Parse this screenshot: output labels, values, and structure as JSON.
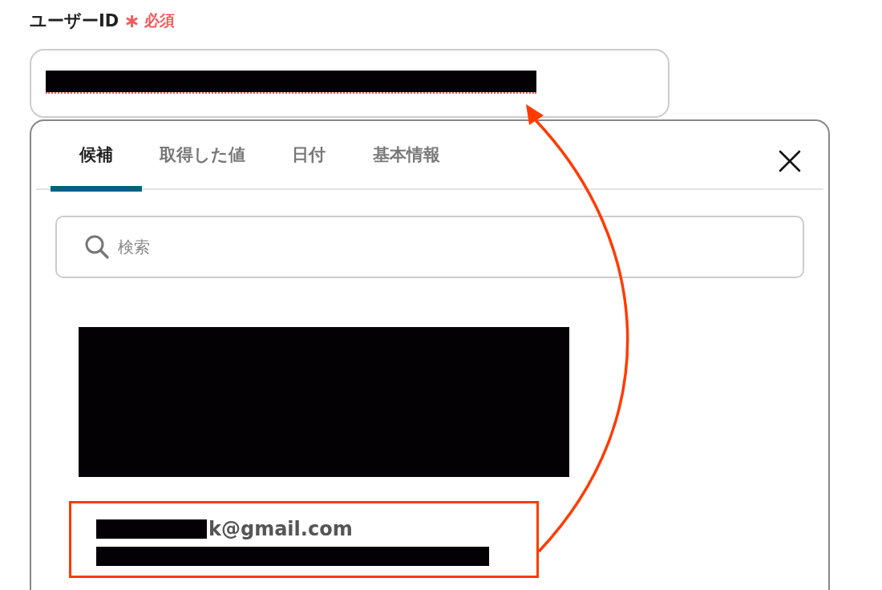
{
  "field": {
    "label": "ユーザーID",
    "required_mark": "∗",
    "required_text": "必須"
  },
  "tabs": [
    {
      "label": "候補",
      "selected": true
    },
    {
      "label": "取得した値",
      "selected": false
    },
    {
      "label": "日付",
      "selected": false
    },
    {
      "label": "基本情報",
      "selected": false
    }
  ],
  "search": {
    "placeholder": "検索"
  },
  "suggestion": {
    "email": "k@gmail.com",
    "highlighted": true
  }
}
